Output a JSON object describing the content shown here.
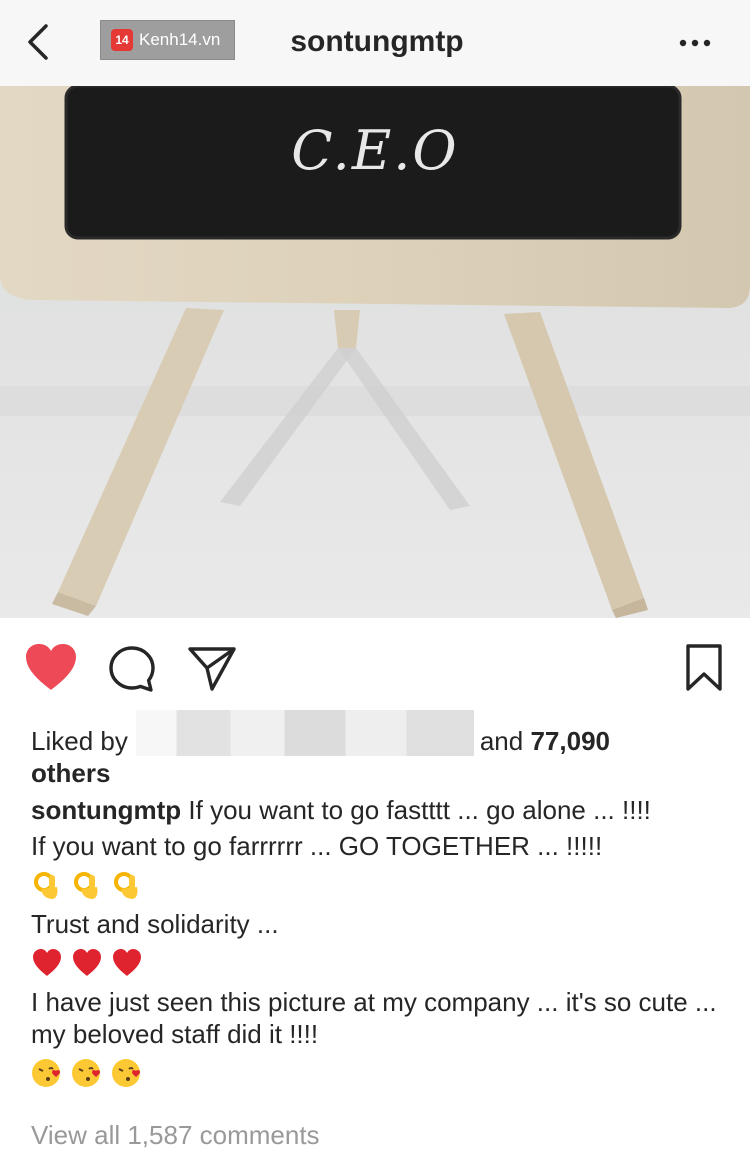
{
  "header": {
    "title": "sontungmtp",
    "watermark_badge": "14",
    "watermark_text": "Kenh14.vn",
    "back_icon": "chevron-left-icon",
    "more_icon": "ellipsis-icon"
  },
  "photo": {
    "board_text": "C.E.O"
  },
  "actions": {
    "liked": true,
    "like_color": "#ed4956",
    "icons": [
      "heart-icon",
      "comment-icon",
      "share-icon",
      "bookmark-icon"
    ]
  },
  "likes": {
    "prefix": "Liked by",
    "middle": "and",
    "count": "77,090",
    "suffix": "others"
  },
  "caption": {
    "username": "sontungmtp",
    "line1": "If you want to go fastttt ... go alone ... !!!!",
    "line2": "If you want to go farrrrrr ... GO TOGETHER ... !!!!!",
    "line3": "Trust and solidarity ...",
    "line4": "I have just seen this picture at my company ... it's so cute ... my beloved staff did it !!!!",
    "emoji_rows": [
      "ok-hand-emoji",
      "red-heart-emoji",
      "kissing-face-emoji"
    ]
  },
  "comments": {
    "view_all": "View all 1,587 comments"
  }
}
